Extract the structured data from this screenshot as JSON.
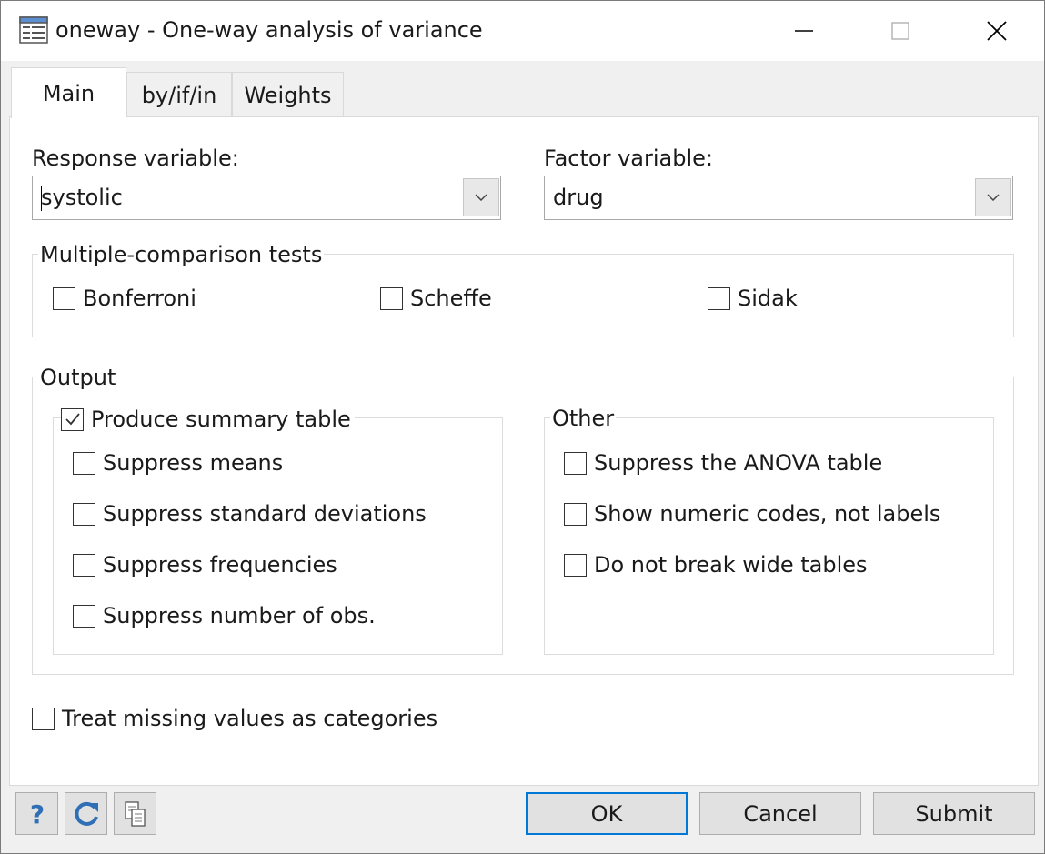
{
  "window": {
    "title": "oneway - One-way analysis of variance"
  },
  "tabs": [
    {
      "label": "Main"
    },
    {
      "label": "by/if/in"
    },
    {
      "label": "Weights"
    }
  ],
  "response": {
    "label": "Response variable:",
    "value": "systolic"
  },
  "factor": {
    "label": "Factor variable:",
    "value": "drug"
  },
  "multiple_comparison": {
    "title": "Multiple-comparison tests",
    "options": [
      {
        "label": "Bonferroni",
        "checked": false
      },
      {
        "label": "Scheffe",
        "checked": false
      },
      {
        "label": "Sidak",
        "checked": false
      }
    ]
  },
  "output": {
    "title": "Output",
    "summary": {
      "label": "Produce summary table",
      "checked": true,
      "options": [
        {
          "label": "Suppress means",
          "checked": false
        },
        {
          "label": "Suppress standard deviations",
          "checked": false
        },
        {
          "label": "Suppress frequencies",
          "checked": false
        },
        {
          "label": "Suppress number of obs.",
          "checked": false
        }
      ]
    },
    "other": {
      "title": "Other",
      "options": [
        {
          "label": "Suppress the ANOVA table",
          "checked": false
        },
        {
          "label": "Show numeric codes, not labels",
          "checked": false
        },
        {
          "label": "Do not break wide tables",
          "checked": false
        }
      ]
    }
  },
  "missing": {
    "label": "Treat missing values as categories",
    "checked": false
  },
  "footer": {
    "ok": "OK",
    "cancel": "Cancel",
    "submit": "Submit",
    "help_icon": "question-mark-icon",
    "reset_icon": "refresh-icon",
    "copy_icon": "copy-icon"
  },
  "colors": {
    "accent": "#0078d7",
    "icon_blue": "#2f6fb5"
  }
}
